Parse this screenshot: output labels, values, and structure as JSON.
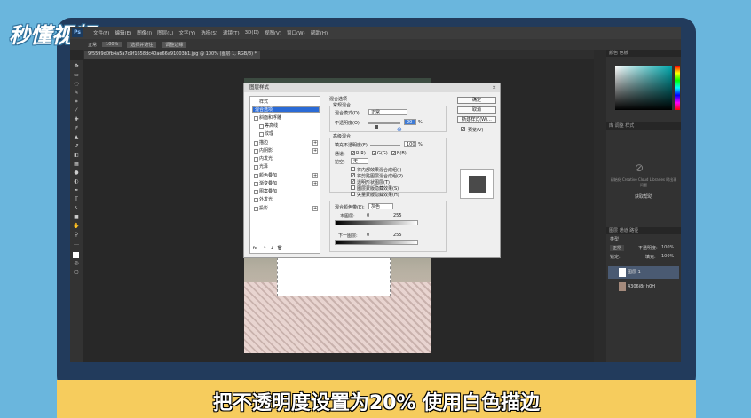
{
  "brand": {
    "logo_text": "秒懂视频"
  },
  "app": {
    "logo": "Ps",
    "menu": [
      "文件(F)",
      "编辑(E)",
      "图像(I)",
      "图层(L)",
      "文字(Y)",
      "选择(S)",
      "滤镜(T)",
      "3D(D)",
      "视图(V)",
      "窗口(W)",
      "帮助(H)"
    ],
    "options": {
      "mode": "正常",
      "opacity": "100%",
      "btn1": "选择并遮住",
      "btn2": "调整边缘"
    },
    "document_tab": "9f5599d0fb4a5a7c9f1658dc40ae66a91003b1.jpg @ 100% (图层 1, RGB/8) *"
  },
  "panels": {
    "color_tab1": "颜色",
    "color_tab2": "色板",
    "libraries_tab1": "库",
    "libraries_tab2": "调整",
    "libraries_tab3": "样式",
    "libraries_msg": "初始化 Creative Cloud Libraries 时出现问题",
    "libraries_link": "获取帮助",
    "layers_tab1": "图层",
    "layers_tab2": "通道",
    "layers_tab3": "路径",
    "layers_kind": "类型",
    "layers_blend": "正常",
    "layers_opacity_label": "不透明度:",
    "layers_opacity": "100%",
    "layers_lock": "锁定:",
    "layers_fill_label": "填充:",
    "layers_fill": "100%",
    "layer1": "图层 1",
    "layer2": "4306j8r h0H"
  },
  "dialog": {
    "title": "图层样式",
    "close": "×",
    "left_list": [
      "样式",
      "混合选项",
      "斜面和浮雕",
      "等高线",
      "纹理",
      "描边",
      "内阴影",
      "内发光",
      "光泽",
      "颜色叠加",
      "渐变叠加",
      "图案叠加",
      "外发光",
      "投影"
    ],
    "fx_label": "fx",
    "section_title": "混合选项",
    "general_title": "常规混合",
    "blend_mode_label": "混合模式(D):",
    "blend_mode_value": "正常",
    "opacity_label": "不透明度(O):",
    "opacity_value": "20",
    "percent": "%",
    "advanced_title": "高级混合",
    "fill_opacity_label": "填充不透明度(F):",
    "fill_opacity_value": "100",
    "channels_label": "通道:",
    "channels": [
      "R(R)",
      "G(G)",
      "B(B)"
    ],
    "knockout_label": "挖空:",
    "knockout_value": "无",
    "options": [
      "将内部效果混合成组(I)",
      "将剪贴图层混合成组(P)",
      "透明形状图层(T)",
      "图层蒙版隐藏效果(S)",
      "矢量蒙版隐藏效果(H)"
    ],
    "blend_if_label": "混合颜色带(E):",
    "blend_if_value": "灰色",
    "this_layer_label": "本图层:",
    "below_layer_label": "下一图层:",
    "range_min": "0",
    "range_max": "255",
    "buttons": {
      "ok": "确定",
      "cancel": "取消",
      "new_style": "新建样式(W)...",
      "preview": "预览(V)"
    }
  },
  "caption": "把不透明度设置为20% 使用白色描边"
}
